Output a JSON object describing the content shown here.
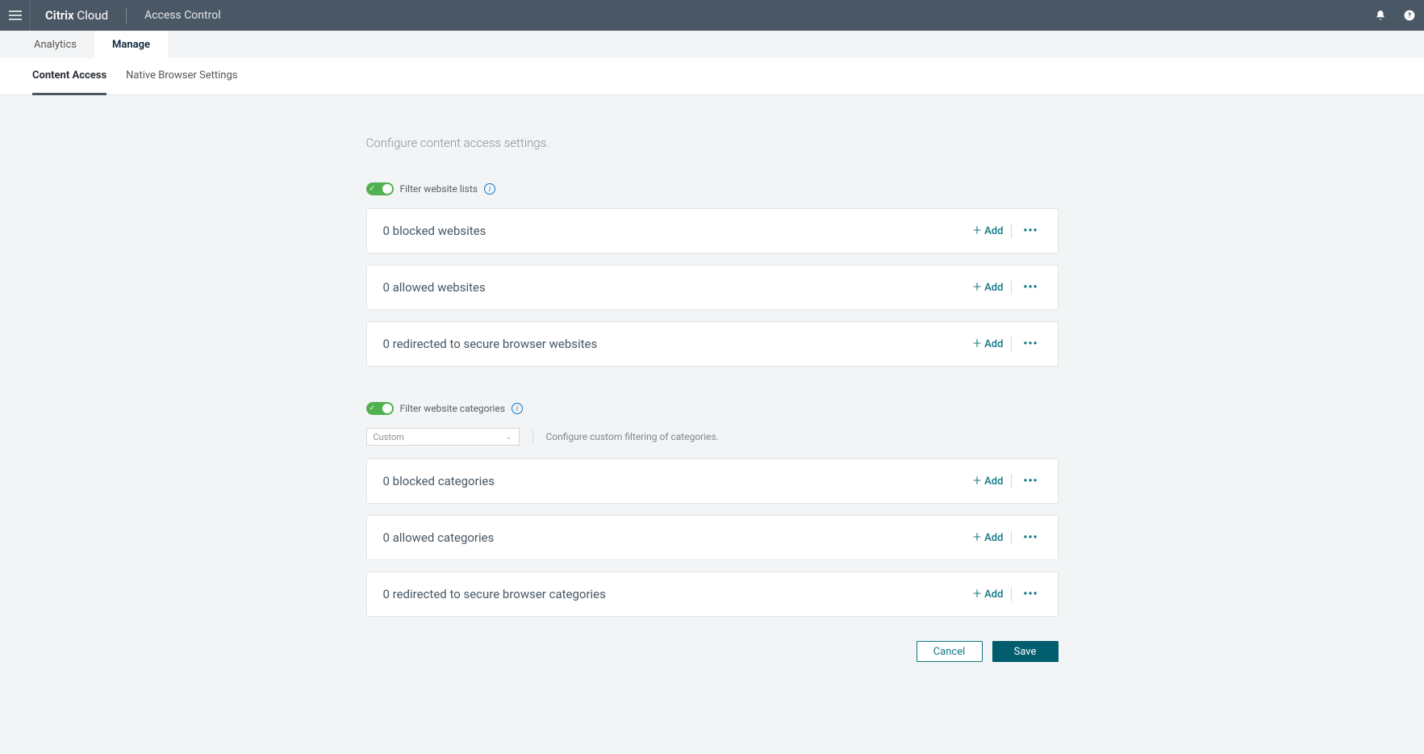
{
  "topbar": {
    "brand_bold": "Citrix",
    "brand_light": "Cloud",
    "section": "Access Control",
    "icons": {
      "bell": "notifications-icon",
      "help": "help-icon"
    }
  },
  "primary_tabs": [
    {
      "label": "Analytics",
      "active": false
    },
    {
      "label": "Manage",
      "active": true
    }
  ],
  "secondary_tabs": [
    {
      "label": "Content Access",
      "active": true
    },
    {
      "label": "Native Browser Settings",
      "active": false
    }
  ],
  "intro": "Configure content access settings.",
  "toggles": {
    "website_lists": {
      "label": "Filter website lists",
      "on": true
    },
    "website_categories": {
      "label": "Filter website categories",
      "on": true
    }
  },
  "cards_websites": [
    {
      "title": "0 blocked websites",
      "add": "Add"
    },
    {
      "title": "0 allowed websites",
      "add": "Add"
    },
    {
      "title": "0 redirected to secure browser websites",
      "add": "Add"
    }
  ],
  "category_select": {
    "value": "Custom",
    "description": "Configure custom filtering of categories."
  },
  "cards_categories": [
    {
      "title": "0 blocked categories",
      "add": "Add"
    },
    {
      "title": "0 allowed categories",
      "add": "Add"
    },
    {
      "title": "0 redirected to secure browser categories",
      "add": "Add"
    }
  ],
  "buttons": {
    "cancel": "Cancel",
    "save": "Save"
  }
}
